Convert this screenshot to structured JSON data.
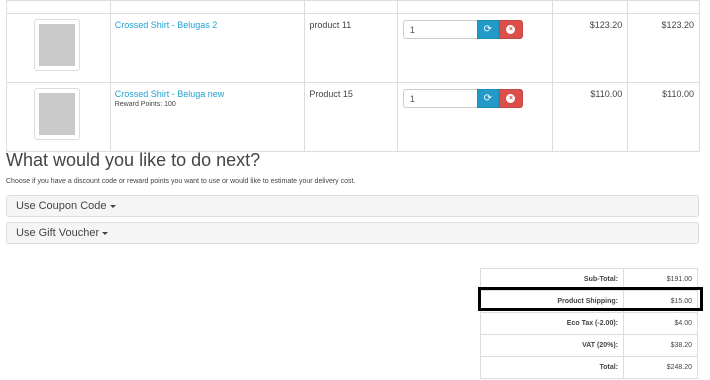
{
  "cart": {
    "items": [
      {
        "name": "Crossed Shirt - Belugas 2",
        "reward": "",
        "model": "product 11",
        "quantity": "1",
        "unit_price": "$123.20",
        "total": "$123.20"
      },
      {
        "name": "Crossed Shirt - Beluga new",
        "reward": "Reward Points: 100",
        "model": "Product 15",
        "quantity": "1",
        "unit_price": "$110.00",
        "total": "$110.00"
      }
    ]
  },
  "next": {
    "title": "What would you like to do next?",
    "description": "Choose if you have a discount code or reward points you want to use or would like to estimate your delivery cost."
  },
  "panels": {
    "coupon": "Use Coupon Code",
    "voucher": "Use Gift Voucher"
  },
  "totals": [
    {
      "label": "Sub-Total:",
      "value": "$191.00"
    },
    {
      "label": "Product Shipping:",
      "value": "$15.00"
    },
    {
      "label": "Eco Tax (-2.00):",
      "value": "$4.00"
    },
    {
      "label": "VAT (20%):",
      "value": "$38.20"
    },
    {
      "label": "Total:",
      "value": "$248.20"
    }
  ],
  "icons": {
    "update": "refresh-icon",
    "remove": "times-circle-icon"
  },
  "colors": {
    "link": "#23a1d1",
    "update_button": "#229ac8",
    "remove_button": "#da4f49",
    "highlight_border": "#000000"
  }
}
